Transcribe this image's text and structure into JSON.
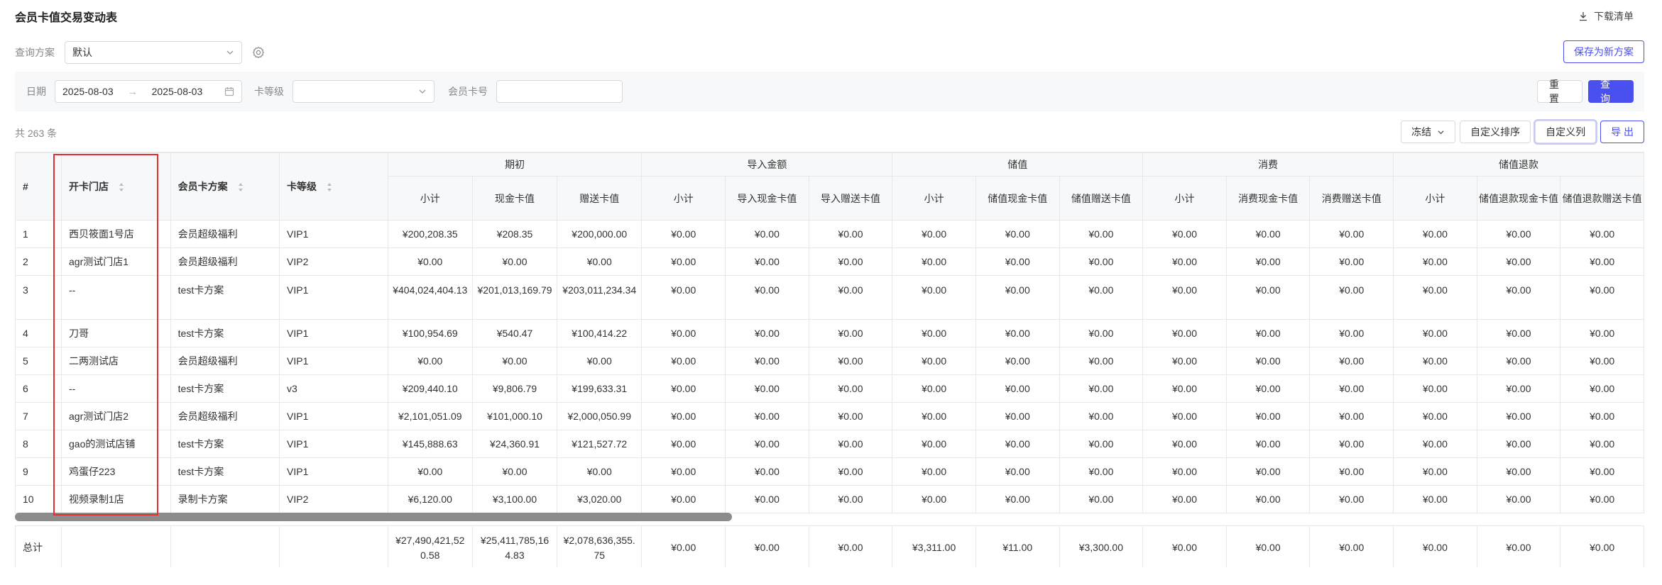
{
  "header": {
    "title": "会员卡值交易变动表",
    "download_label": "下载清单"
  },
  "scheme": {
    "label": "查询方案",
    "value": "默认",
    "save_label": "保存为新方案"
  },
  "filter": {
    "date_label": "日期",
    "date_start": "2025-08-03",
    "date_end": "2025-08-03",
    "level_label": "卡等级",
    "level_value": "",
    "card_label": "会员卡号",
    "card_value": "",
    "reset_label": "重 置",
    "query_label": "查 询"
  },
  "summary": {
    "count_text": "共 263 条"
  },
  "toolbar": {
    "freeze_label": "冻结",
    "custom_sort_label": "自定义排序",
    "custom_col_label": "自定义列",
    "export_label": "导 出"
  },
  "table": {
    "col_index": "#",
    "col_store": "开卡门店",
    "col_plan": "会员卡方案",
    "col_level": "卡等级",
    "groups": [
      "期初",
      "导入金额",
      "储值",
      "消费",
      "储值退款"
    ],
    "sub_cols": [
      "小计",
      "现金卡值",
      "赠送卡值",
      "小计",
      "导入现金卡值",
      "导入赠送卡值",
      "小计",
      "储值现金卡值",
      "储值赠送卡值",
      "小计",
      "消费现金卡值",
      "消费赠送卡值",
      "小计",
      "储值退款现金卡值",
      "储值退款赠送卡值"
    ],
    "rows": [
      {
        "idx": "1",
        "store": "西贝筱面1号店",
        "plan": "会员超级福利",
        "level": "VIP1",
        "v": [
          "¥200,208.35",
          "¥208.35",
          "¥200,000.00",
          "¥0.00",
          "¥0.00",
          "¥0.00",
          "¥0.00",
          "¥0.00",
          "¥0.00",
          "¥0.00",
          "¥0.00",
          "¥0.00",
          "¥0.00",
          "¥0.00",
          "¥0.00"
        ]
      },
      {
        "idx": "2",
        "store": "agr测试门店1",
        "plan": "会员超级福利",
        "level": "VIP2",
        "v": [
          "¥0.00",
          "¥0.00",
          "¥0.00",
          "¥0.00",
          "¥0.00",
          "¥0.00",
          "¥0.00",
          "¥0.00",
          "¥0.00",
          "¥0.00",
          "¥0.00",
          "¥0.00",
          "¥0.00",
          "¥0.00",
          "¥0.00"
        ]
      },
      {
        "idx": "3",
        "store": "--",
        "plan": "test卡方案",
        "level": "VIP1",
        "tall": true,
        "v": [
          "¥404,024,404.13",
          "¥201,013,169.79",
          "¥203,011,234.34",
          "¥0.00",
          "¥0.00",
          "¥0.00",
          "¥0.00",
          "¥0.00",
          "¥0.00",
          "¥0.00",
          "¥0.00",
          "¥0.00",
          "¥0.00",
          "¥0.00",
          "¥0.00"
        ]
      },
      {
        "idx": "4",
        "store": "刀哥",
        "plan": "test卡方案",
        "level": "VIP1",
        "v": [
          "¥100,954.69",
          "¥540.47",
          "¥100,414.22",
          "¥0.00",
          "¥0.00",
          "¥0.00",
          "¥0.00",
          "¥0.00",
          "¥0.00",
          "¥0.00",
          "¥0.00",
          "¥0.00",
          "¥0.00",
          "¥0.00",
          "¥0.00"
        ]
      },
      {
        "idx": "5",
        "store": "二两测试店",
        "plan": "会员超级福利",
        "level": "VIP1",
        "v": [
          "¥0.00",
          "¥0.00",
          "¥0.00",
          "¥0.00",
          "¥0.00",
          "¥0.00",
          "¥0.00",
          "¥0.00",
          "¥0.00",
          "¥0.00",
          "¥0.00",
          "¥0.00",
          "¥0.00",
          "¥0.00",
          "¥0.00"
        ]
      },
      {
        "idx": "6",
        "store": "--",
        "plan": "test卡方案",
        "level": "v3",
        "v": [
          "¥209,440.10",
          "¥9,806.79",
          "¥199,633.31",
          "¥0.00",
          "¥0.00",
          "¥0.00",
          "¥0.00",
          "¥0.00",
          "¥0.00",
          "¥0.00",
          "¥0.00",
          "¥0.00",
          "¥0.00",
          "¥0.00",
          "¥0.00"
        ]
      },
      {
        "idx": "7",
        "store": "agr测试门店2",
        "plan": "会员超级福利",
        "level": "VIP1",
        "v": [
          "¥2,101,051.09",
          "¥101,000.10",
          "¥2,000,050.99",
          "¥0.00",
          "¥0.00",
          "¥0.00",
          "¥0.00",
          "¥0.00",
          "¥0.00",
          "¥0.00",
          "¥0.00",
          "¥0.00",
          "¥0.00",
          "¥0.00",
          "¥0.00"
        ]
      },
      {
        "idx": "8",
        "store": "gao的测试店铺",
        "plan": "test卡方案",
        "level": "VIP1",
        "v": [
          "¥145,888.63",
          "¥24,360.91",
          "¥121,527.72",
          "¥0.00",
          "¥0.00",
          "¥0.00",
          "¥0.00",
          "¥0.00",
          "¥0.00",
          "¥0.00",
          "¥0.00",
          "¥0.00",
          "¥0.00",
          "¥0.00",
          "¥0.00"
        ]
      },
      {
        "idx": "9",
        "store": "鸡蛋仔223",
        "plan": "test卡方案",
        "level": "VIP1",
        "v": [
          "¥0.00",
          "¥0.00",
          "¥0.00",
          "¥0.00",
          "¥0.00",
          "¥0.00",
          "¥0.00",
          "¥0.00",
          "¥0.00",
          "¥0.00",
          "¥0.00",
          "¥0.00",
          "¥0.00",
          "¥0.00",
          "¥0.00"
        ]
      },
      {
        "idx": "10",
        "store": "视频录制1店",
        "plan": "录制卡方案",
        "level": "VIP2",
        "v": [
          "¥6,120.00",
          "¥3,100.00",
          "¥3,020.00",
          "¥0.00",
          "¥0.00",
          "¥0.00",
          "¥0.00",
          "¥0.00",
          "¥0.00",
          "¥0.00",
          "¥0.00",
          "¥0.00",
          "¥0.00",
          "¥0.00",
          "¥0.00"
        ]
      }
    ],
    "total": {
      "label": "总计",
      "v": [
        "¥27,490,421,520.58",
        "¥25,411,785,164.83",
        "¥2,078,636,355.75",
        "¥0.00",
        "¥0.00",
        "¥0.00",
        "¥3,311.00",
        "¥11.00",
        "¥3,300.00",
        "¥0.00",
        "¥0.00",
        "¥0.00",
        "¥0.00",
        "¥0.00",
        "¥0.00"
      ]
    }
  },
  "colors": {
    "primary": "#4a4ff0",
    "highlight": "#e03030",
    "header_bg": "#f7f8fa"
  }
}
